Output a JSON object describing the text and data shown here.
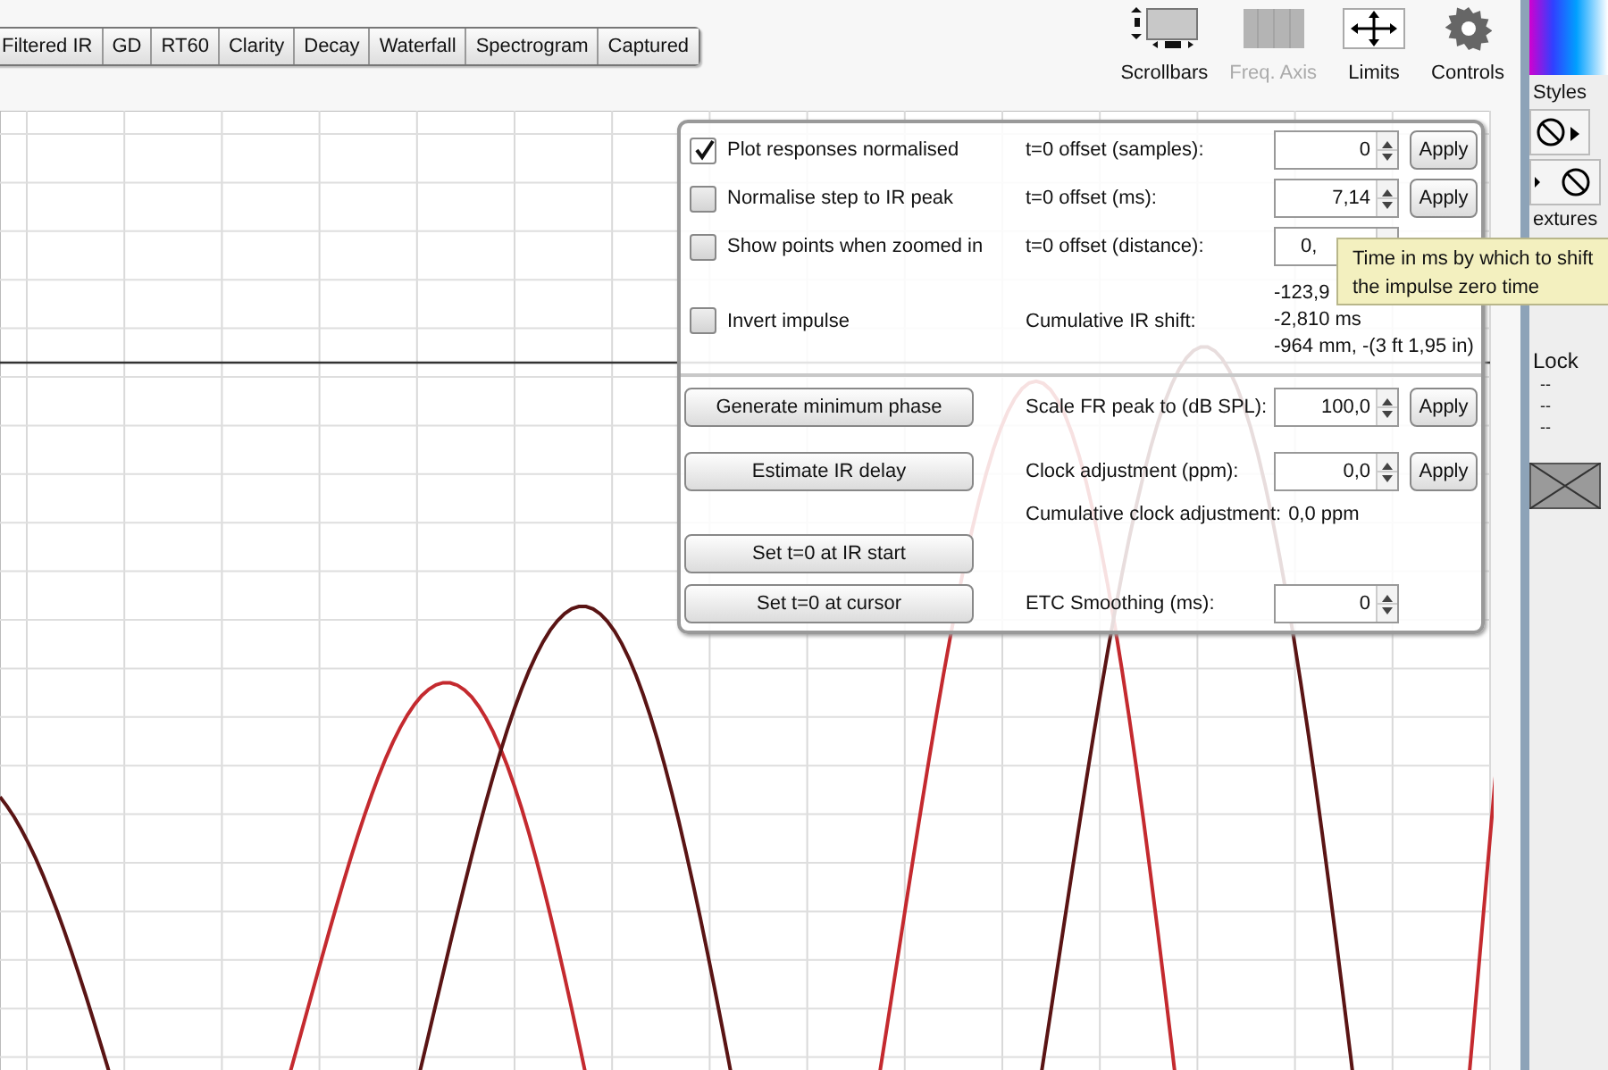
{
  "tabs": [
    {
      "label": "Filtered IR",
      "selected": false
    },
    {
      "label": "GD",
      "selected": false
    },
    {
      "label": "RT60",
      "selected": false
    },
    {
      "label": "Clarity",
      "selected": false
    },
    {
      "label": "Decay",
      "selected": false
    },
    {
      "label": "Waterfall",
      "selected": false
    },
    {
      "label": "Spectrogram",
      "selected": false
    },
    {
      "label": "Captured",
      "selected": false
    }
  ],
  "toolbar": [
    {
      "kind": "scrollbars",
      "label": "Scrollbars",
      "disabled": false
    },
    {
      "kind": "freq-axis",
      "label": "Freq. Axis",
      "disabled": true
    },
    {
      "kind": "limits",
      "label": "Limits",
      "disabled": false
    },
    {
      "kind": "controls",
      "label": "Controls",
      "disabled": false
    }
  ],
  "plot": {
    "curves": [
      {
        "color": "#c42a2f"
      },
      {
        "color": "#5a1414"
      }
    ]
  },
  "panel": {
    "sections": [
      {
        "rows": [
          {
            "kind": "control",
            "left": {
              "kind": "checkbox",
              "label": "Plot responses normalised",
              "checked": true
            },
            "label": "t=0 offset (samples):",
            "field": "0",
            "apply": "Apply"
          },
          {
            "kind": "control",
            "left": {
              "kind": "checkbox",
              "label": "Normalise step to IR peak",
              "checked": false
            },
            "label": "t=0 offset (ms):",
            "field": "7,14",
            "apply": "Apply"
          },
          {
            "kind": "covered",
            "left": {
              "kind": "checkbox",
              "label": "Show points when zoomed in",
              "checked": false
            },
            "label": "t=0 offset (distance):",
            "field": "0,"
          },
          {
            "kind": "readout",
            "left": {
              "kind": "checkbox",
              "label": "Invert impulse",
              "checked": false
            },
            "label": "Cumulative IR shift:",
            "lines": [
              "-123,9",
              "-2,810 ms",
              "-964 mm, -(3 ft 1,95 in)"
            ]
          }
        ]
      },
      {
        "rows": [
          {
            "kind": "control",
            "left": {
              "kind": "button",
              "label": "Generate minimum phase"
            },
            "label": "Scale FR peak to (dB SPL):",
            "field": "100,0",
            "apply": "Apply"
          },
          {
            "kind": "control",
            "left": {
              "kind": "button",
              "label": "Estimate IR delay"
            },
            "label": "Clock adjustment (ppm):",
            "field": "0,0",
            "apply": "Apply"
          },
          {
            "kind": "summary",
            "label": "Cumulative clock adjustment:",
            "value": "0,0 ppm"
          },
          {
            "kind": "control",
            "left": {
              "kind": "button",
              "label": "Set t=0 at IR start"
            }
          },
          {
            "kind": "control",
            "left": {
              "kind": "button",
              "label": "Set t=0 at cursor"
            },
            "label": "ETC Smoothing (ms):",
            "field": "0"
          }
        ]
      }
    ]
  },
  "tooltip": {
    "lines": [
      "Time in ms by which to shift",
      "the impulse zero time"
    ]
  },
  "side": {
    "styles_label": "Styles",
    "textures_label": "extures",
    "lock_label": "Lock",
    "dashes": [
      "--",
      "--",
      "--"
    ]
  }
}
